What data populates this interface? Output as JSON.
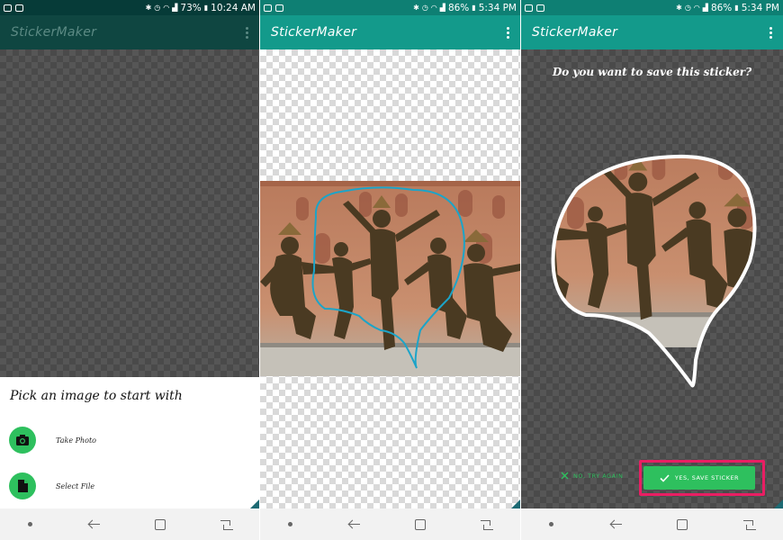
{
  "colors": {
    "status_dark": "#063b38",
    "appbar_dark": "#0f4641",
    "status_teal": "#0e7f73",
    "appbar_teal": "#139a8b",
    "accent_green": "#2ec05e",
    "highlight_pink": "#e91e63",
    "draw_line": "#1ca4c8"
  },
  "panels": [
    {
      "status": {
        "battery": "73%",
        "time": "10:24 AM"
      },
      "app_title": "StickerMaker",
      "sheet": {
        "title": "Pick an image to start with",
        "options": [
          {
            "label": "Take Photo",
            "icon": "camera-icon"
          },
          {
            "label": "Select File",
            "icon": "file-icon"
          }
        ]
      }
    },
    {
      "status": {
        "battery": "86%",
        "time": "5:34 PM"
      },
      "app_title": "StickerMaker"
    },
    {
      "status": {
        "battery": "86%",
        "time": "5:34 PM"
      },
      "app_title": "StickerMaker",
      "question": "Do you want to save this sticker?",
      "no_label": "NO, TRY AGAIN",
      "yes_label": "YES, SAVE STICKER"
    }
  ]
}
